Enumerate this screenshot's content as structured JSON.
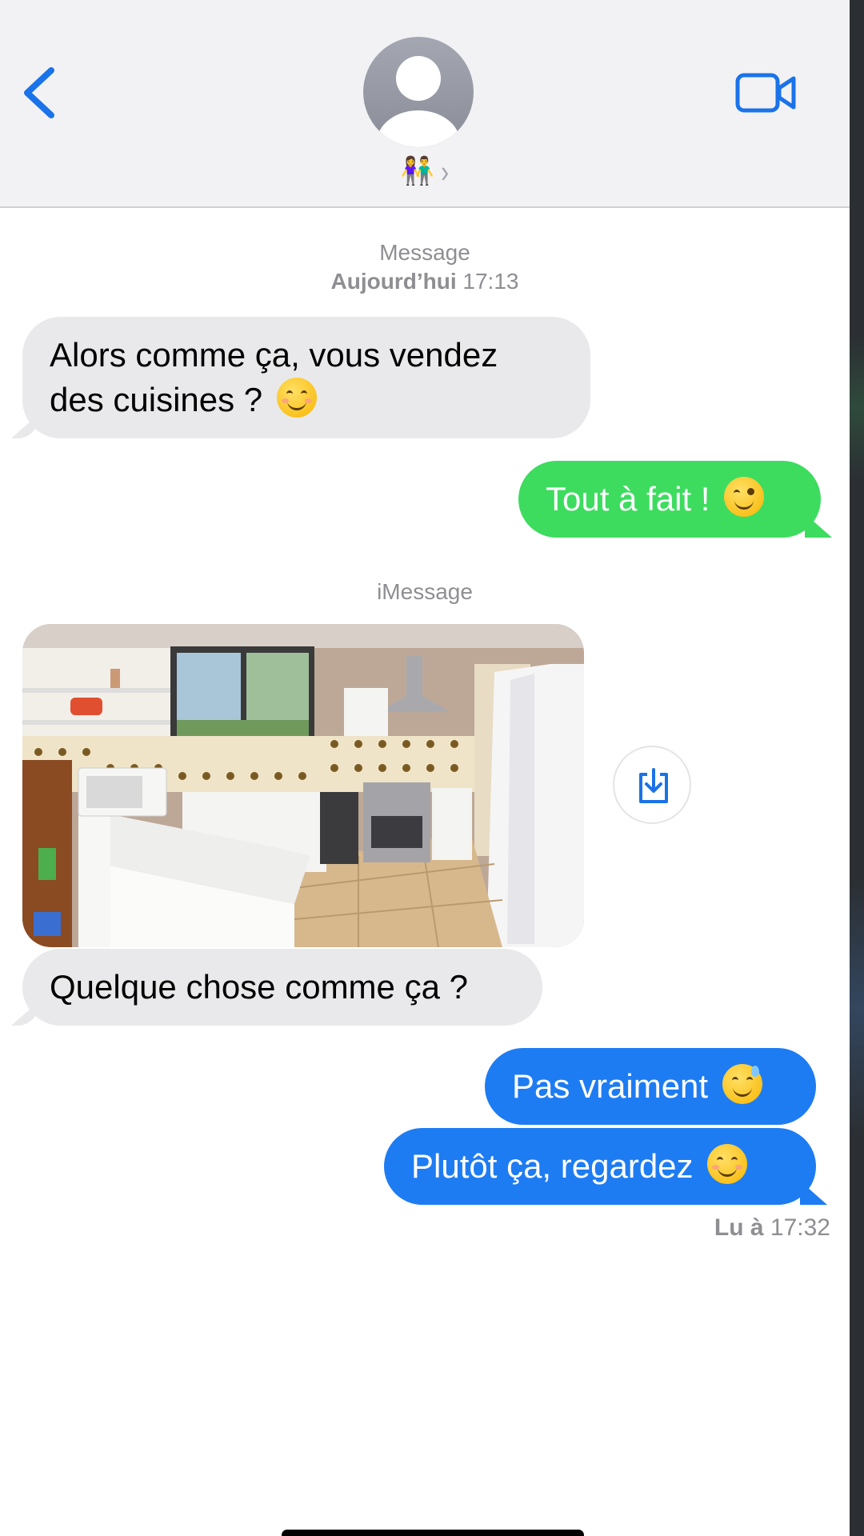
{
  "header": {
    "contact_name": "👫",
    "chevron": "›",
    "back_icon": "chevron-left-icon",
    "video_icon": "video-camera-icon",
    "accent_color": "#1a73e8"
  },
  "conversation": {
    "meta1": {
      "service": "Message",
      "day": "Aujourd’hui",
      "time": "17:13"
    },
    "msg1": {
      "text": "Alors comme ça, vous vendez",
      "text2": "des cuisines ?",
      "emoji": "😊"
    },
    "msg2": {
      "text": "Tout à fait !",
      "emoji": "😉"
    },
    "meta2": {
      "service": "iMessage"
    },
    "photo": {
      "alt": "kitchen-photo",
      "save_icon": "save-download-icon"
    },
    "msg3": {
      "text": "Quelque chose comme ça ?"
    },
    "msg4": {
      "text": "Pas vraiment",
      "emoji": "😅"
    },
    "msg5": {
      "text": "Plutôt ça, regardez",
      "emoji": "😊"
    },
    "read_receipt": {
      "label": "Lu à",
      "time": "17:32"
    }
  },
  "colors": {
    "incoming_bubble": "#e9e9eb",
    "sms_bubble": "#3ddc5f",
    "imessage_bubble": "#1e7cf2"
  }
}
